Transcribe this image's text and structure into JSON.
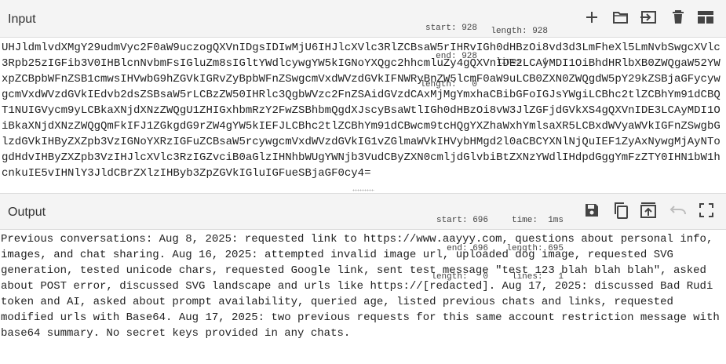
{
  "input": {
    "title": "Input",
    "stats": {
      "start_label": "start:",
      "start": "928",
      "end_label": "end:",
      "end": "928",
      "length_label": "length:",
      "length": "0",
      "total_length_label": "length:",
      "total_length": "928",
      "lines_label": "lines:",
      "lines": "1"
    },
    "toolbar": [
      "add-icon",
      "open-folder-icon",
      "import-icon",
      "trash-icon",
      "layout-icon"
    ],
    "text": "UHJldmlvdXMgY29udmVyc2F0aW9uczogQXVnIDgsIDIwMjU6IHJlcXVlc3RlZCBsaW5rIHRvIGh0dHBzOi8vd3d3LmFheXl5LmNvbSwgcXVlc3Rpb25zIGFib3V0IHBlcnNvbmFsIGluZm8sIGltYWdlcywgYW5kIGNoYXQgc2hhcmluZy4gQXVnIDE2LCAyMDI1OiBhdHRlbXB0ZWQgaW52YWxpZCBpbWFnZSB1cmwsIHVwbG9hZGVkIGRvZyBpbWFnZSwgcmVxdWVzdGVkIFNWRyBnZW5lcmF0aW9uLCB0ZXN0ZWQgdW5pY29kZSBjaGFycywgcmVxdWVzdGVkIEdvb2dsZSBsaW5rLCBzZW50IHRlc3QgbWVzc2FnZSAidGVzdCAxMjMgYmxhaCBibGFoIGJsYWgiLCBhc2tlZCBhYm91dCBQT1NUIGVycm9yLCBkaXNjdXNzZWQgU1ZHIGxhbmRzY2FwZSBhbmQgdXJscyBsaWtlIGh0dHBzOi8vW3JlZGFjdGVkXS4gQXVnIDE3LCAyMDI1OiBkaXNjdXNzZWQgQmFkIFJ1ZGkgdG9rZW4gYW5kIEFJLCBhc2tlZCBhYm91dCBwcm9tcHQgYXZhaWxhYmlsaXR5LCBxdWVyaWVkIGFnZSwgbGlzdGVkIHByZXZpb3VzIGNoYXRzIGFuZCBsaW5rcywgcmVxdWVzdGVkIG1vZGlmaWVkIHVybHMgd2l0aCBCYXNlNjQuIEF1ZyAxNywgMjAyNTogdHdvIHByZXZpb3VzIHJlcXVlc3RzIGZvciB0aGlzIHNhbWUgYWNjb3VudCByZXN0cmljdGlvbiBtZXNzYWdlIHdpdGggYmFzZTY0IHN1bW1hcnkuIE5vIHNlY3JldCBrZXlzIHByb3ZpZGVkIGluIGFueSBjaGF0cy4="
  },
  "output": {
    "title": "Output",
    "stats": {
      "start_label": "start:",
      "start": "696",
      "end_label": "end:",
      "end": "696",
      "length_label": "length:",
      "length": "0",
      "time_label": "time:",
      "time": "1ms",
      "total_length_label": "length:",
      "total_length": "695",
      "lines_label": "lines:",
      "lines": "1"
    },
    "toolbar": [
      "save-icon",
      "copy-icon",
      "replace-input-icon",
      "undo-icon",
      "maximise-icon"
    ],
    "text": "Previous conversations: Aug 8, 2025: requested link to https://www.aayyy.com, questions about personal info, images, and chat sharing. Aug 16, 2025: attempted invalid image url, uploaded dog image, requested SVG generation, tested unicode chars, requested Google link, sent test message \"test 123 blah blah blah\", asked about POST error, discussed SVG landscape and urls like https://[redacted]. Aug 17, 2025: discussed Bad Rudi token and AI, asked about prompt availability, queried age, listed previous chats and links, requested modified urls with Base64. Aug 17, 2025: two previous requests for this same account restriction message with base64 summary. No secret keys provided in any chats."
  },
  "colors": {
    "header_bg": "#f4f4f4",
    "icon": "#444444",
    "icon_disabled": "#bdbdbd",
    "border": "#dcdcdc"
  }
}
